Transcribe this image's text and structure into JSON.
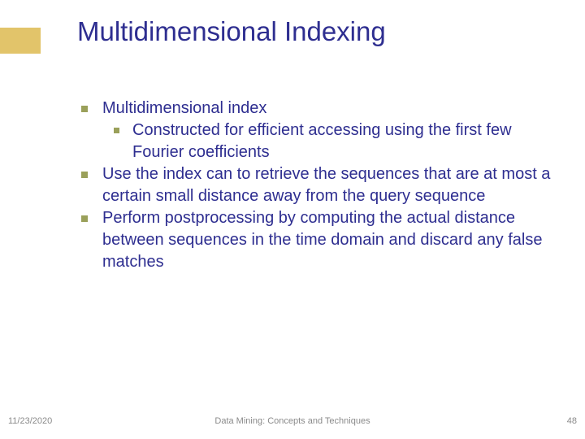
{
  "title": "Multidimensional Indexing",
  "bullets": {
    "b1": "Multidimensional index",
    "b1_1": "Constructed for efficient accessing using the first few Fourier coefficients",
    "b2": "Use the index can to retrieve the sequences that are at most a certain small distance away from the query sequence",
    "b3": "Perform postprocessing by computing the actual distance between sequences in the time domain and discard any false matches"
  },
  "footer": {
    "date": "11/23/2020",
    "center": "Data Mining: Concepts and Techniques",
    "page": "48"
  }
}
